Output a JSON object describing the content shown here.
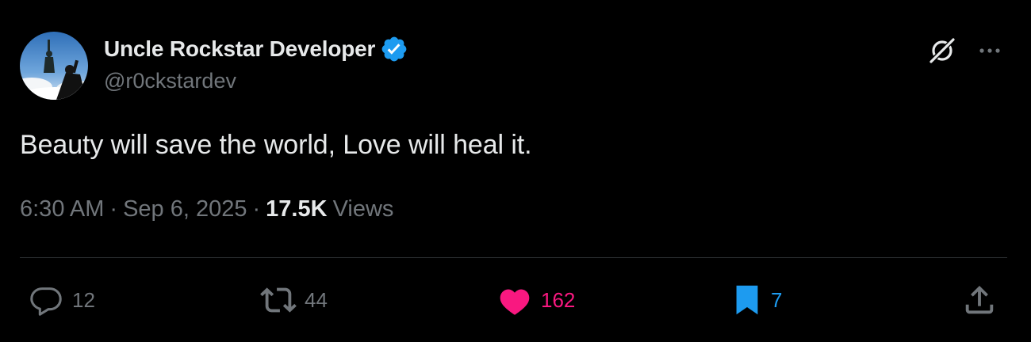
{
  "author": {
    "name": "Uncle Rockstar Developer",
    "handle": "@r0ckstardev",
    "verified": true,
    "avatar_icon": "statue-of-liberty-avatar",
    "badge_icon": "verified-badge-icon"
  },
  "post": {
    "text": "Beauty will save the world, Love will heal it.",
    "time": "6:30 AM",
    "separator": "·",
    "date": "Sep 6, 2025",
    "views_count": "17.5K",
    "views_label": "Views"
  },
  "header_actions": {
    "grok_icon": "grok-icon",
    "more_icon": "more-icon"
  },
  "actions": {
    "reply": {
      "icon": "reply-icon",
      "count": "12"
    },
    "retweet": {
      "icon": "retweet-icon",
      "count": "44"
    },
    "like": {
      "icon": "heart-icon",
      "count": "162",
      "active": true
    },
    "bookmark": {
      "icon": "bookmark-icon",
      "count": "7",
      "active": true
    },
    "share": {
      "icon": "share-icon"
    }
  },
  "colors": {
    "background": "#000000",
    "text_primary": "#e7e9ea",
    "text_secondary": "#71767b",
    "verified": "#1d9bf0",
    "like": "#f91880",
    "bookmark": "#1d9bf0",
    "divider": "#2f3336"
  }
}
